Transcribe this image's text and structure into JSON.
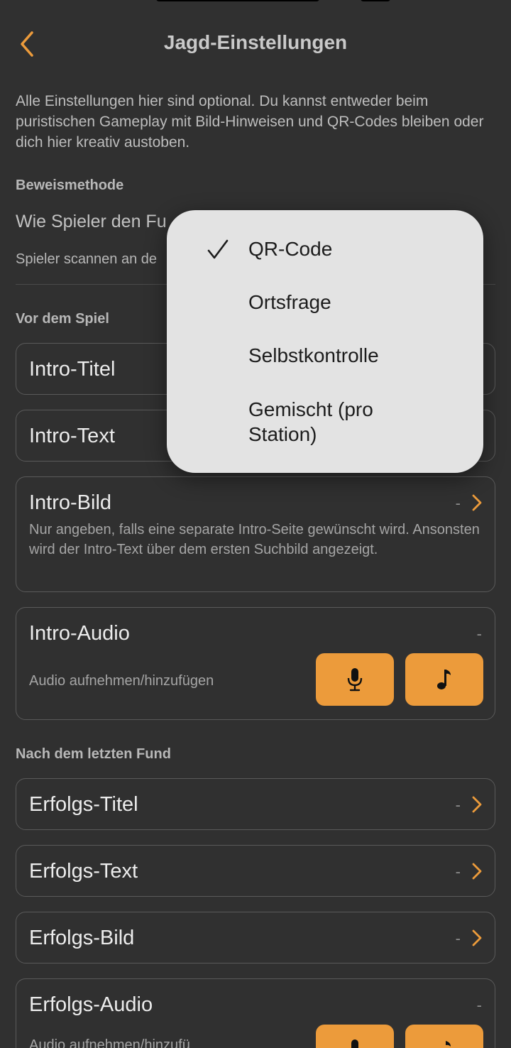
{
  "nav": {
    "title": "Jagd-Einstellungen"
  },
  "description": "Alle Einstellungen hier sind optional. Du kannst entweder beim puristischen Gameplay mit Bild-Hinweisen und QR-Codes bleiben oder dich hier kreativ austoben.",
  "proof_section": {
    "label": "Beweismethode",
    "title_visible": "Wie Spieler den Fu",
    "subtitle_visible": "Spieler scannen an de"
  },
  "before_section": {
    "label": "Vor dem Spiel",
    "intro_title": {
      "label": "Intro-Titel"
    },
    "intro_text": {
      "label": "Intro-Text"
    },
    "intro_image": {
      "label": "Intro-Bild",
      "value": "-",
      "hint": "Nur angeben, falls eine separate Intro-Seite gewünscht wird. Ansonsten wird der Intro-Text über dem ersten Suchbild angezeigt."
    },
    "intro_audio": {
      "label": "Intro-Audio",
      "value": "-",
      "hint": "Audio aufnehmen/hinzufügen"
    }
  },
  "after_section": {
    "label": "Nach dem letzten Fund",
    "success_title": {
      "label": "Erfolgs-Titel",
      "value": "-"
    },
    "success_text": {
      "label": "Erfolgs-Text",
      "value": "-"
    },
    "success_image": {
      "label": "Erfolgs-Bild",
      "value": "-"
    },
    "success_audio": {
      "label": "Erfolgs-Audio",
      "value": "-",
      "hint_visible": "Audio aufnehmen/hinzufü"
    }
  },
  "popup_menu": {
    "items": [
      "QR-Code",
      "Ortsfrage",
      "Selbstkontrolle",
      "Gemischt (pro Station)"
    ],
    "selected": "QR-Code"
  },
  "colors": {
    "background": "#303030",
    "accent": "#ec9b3b",
    "popup_bg": "#e3e3e3"
  },
  "icons": {
    "back": "chevron-left-icon",
    "chevron": "chevron-right-icon",
    "mic": "microphone-icon",
    "music": "music-note-icon",
    "check": "checkmark-icon"
  }
}
